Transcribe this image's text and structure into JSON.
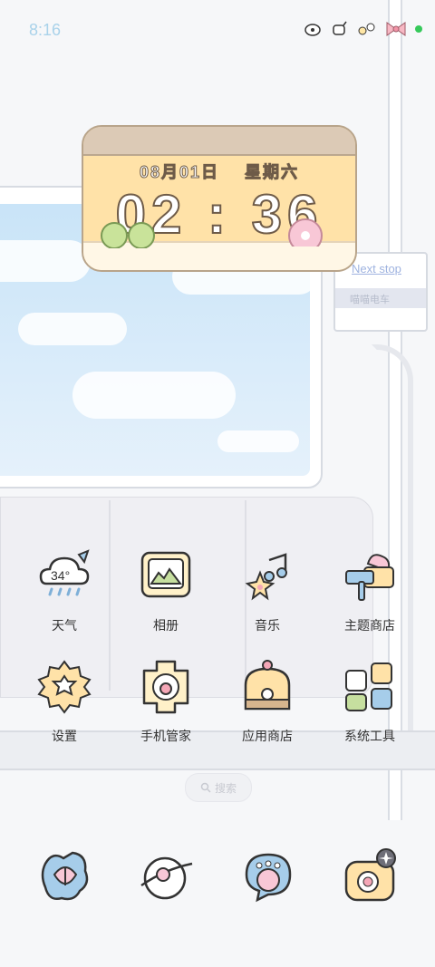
{
  "status_bar": {
    "time": "8:16",
    "icons": [
      "turtle-icon",
      "hand-icon",
      "candy-icon",
      "bow-icon"
    ],
    "dot_color": "#35c95a"
  },
  "sign": {
    "top": "Next stop",
    "bar": "喵喵电车"
  },
  "clock_widget": {
    "date": "08月01日",
    "weekday": "星期六",
    "time": "02 : 36"
  },
  "apps": [
    {
      "label": "天气",
      "icon": "weather-icon",
      "badge": "34°"
    },
    {
      "label": "相册",
      "icon": "gallery-icon"
    },
    {
      "label": "音乐",
      "icon": "music-icon"
    },
    {
      "label": "主题商店",
      "icon": "theme-store-icon"
    },
    {
      "label": "设置",
      "icon": "settings-icon"
    },
    {
      "label": "手机管家",
      "icon": "phone-manager-icon"
    },
    {
      "label": "应用商店",
      "icon": "app-store-icon"
    },
    {
      "label": "系统工具",
      "icon": "system-tools-icon"
    }
  ],
  "search": {
    "label": "搜索"
  },
  "dock": [
    "phone-icon",
    "browser-icon",
    "messages-icon",
    "camera-icon"
  ]
}
